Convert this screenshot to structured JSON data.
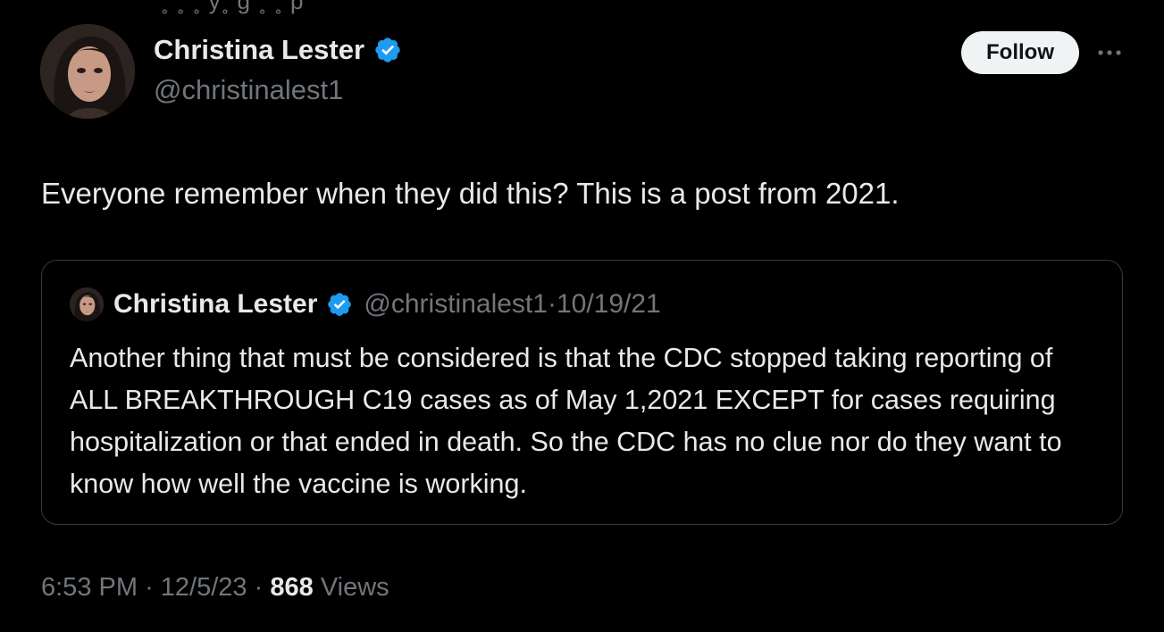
{
  "author": {
    "display_name": "Christina Lester",
    "handle": "@christinalest1",
    "verified_icon": "verified-badge-icon",
    "badge_color": "#1d9bf0"
  },
  "actions": {
    "follow_label": "Follow",
    "more_icon": "more-options-icon"
  },
  "tweet": {
    "text": "Everyone remember when they did this? This is a post from 2021."
  },
  "quoted_tweet": {
    "display_name": "Christina Lester",
    "handle": "@christinalest1",
    "separator": "·",
    "date": "10/19/21",
    "text": "Another thing that must be considered is that the CDC stopped taking reporting of ALL BREAKTHROUGH C19 cases as of May 1,2021 EXCEPT for cases requiring hospitalization or that ended in death. So the CDC has no clue nor do they want to know how well the vaccine is working."
  },
  "meta": {
    "time": "6:53 PM",
    "separator": "·",
    "date": "12/5/23",
    "views_count": "868",
    "views_label": "Views"
  }
}
